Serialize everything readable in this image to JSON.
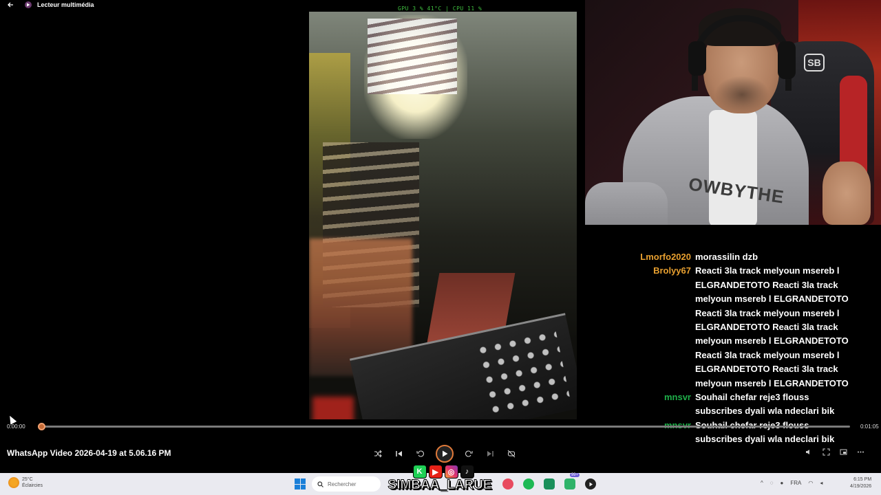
{
  "player": {
    "app_title": "Lecteur multimédia",
    "video_title": "WhatsApp Video 2026-04-19 at 5.06.16 PM",
    "time_elapsed": "0:00:00",
    "time_total": "0:01:05",
    "progress_fraction": 0.004,
    "overlay_stats": "GPU  3 %  41°C  |  CPU  11 %"
  },
  "chat": [
    {
      "user": "Lmorfo2020",
      "color": "#e8a030",
      "text": "morassilin dzb"
    },
    {
      "user": "Brolyy67",
      "color": "#e8a030",
      "text": "Reacti 3la track melyoun msereb l ELGRANDETOTO Reacti 3la track melyoun msereb l ELGRANDETOTO Reacti 3la track melyoun msereb l ELGRANDETOTO Reacti 3la track melyoun msereb l ELGRANDETOTO Reacti 3la track melyoun msereb l ELGRANDETOTO Reacti 3la track melyoun msereb l ELGRANDETOTO"
    },
    {
      "user": "mnsvr",
      "color": "#1fb04a",
      "text": "Souhail chefar reje3 flouss subscribes dyali wla ndeclari bik"
    },
    {
      "user": "mnsvr",
      "color": "#1fb04a",
      "text": "Souhail chefar reje3 flouss subscribes dyali wla ndeclari bik"
    }
  ],
  "overlay": {
    "webcam_logo": "SB",
    "hoodie_text": "OWBYTHE",
    "brand_name": "SIMBAA_LARUE"
  },
  "taskbar": {
    "weather_temp": "25°C",
    "weather_desc": "Éclaircies",
    "search_placeholder": "Rechercher",
    "language": "FRA",
    "clock_time": "6:15 PM",
    "clock_date": "4/19/2026",
    "notification_badge": "99+"
  }
}
